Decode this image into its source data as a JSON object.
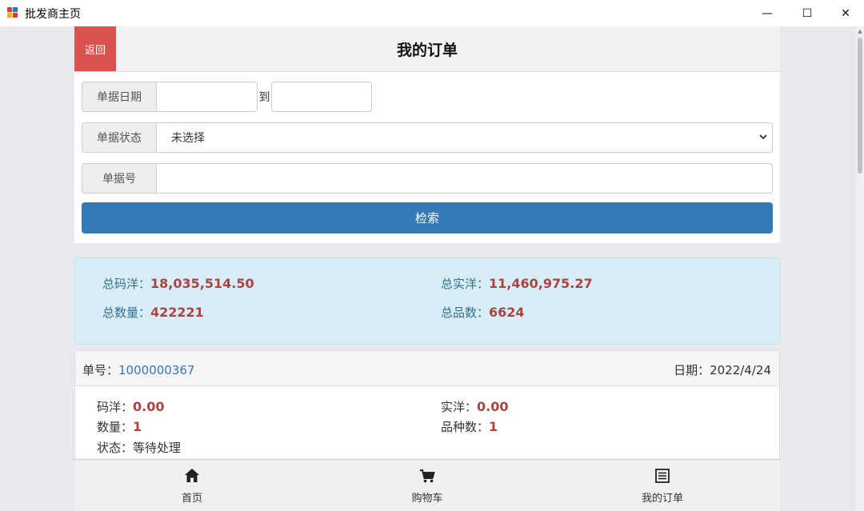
{
  "window": {
    "title": "批发商主页",
    "min_glyph": "—",
    "max_glyph": "☐",
    "close_glyph": "✕"
  },
  "header": {
    "back_label": "返回",
    "title": "我的订单"
  },
  "form": {
    "date_label": "单据日期",
    "date_from": "",
    "to_label": "到",
    "date_to": "",
    "status_label": "单据状态",
    "status_value": "未选择",
    "number_label": "单据号",
    "number_value": "",
    "search_label": "检索"
  },
  "summary": {
    "total_tag_label": "总码洋：",
    "total_tag_value": "18,035,514.50",
    "total_actual_label": "总实洋：",
    "total_actual_value": "11,460,975.27",
    "total_qty_label": "总数量：",
    "total_qty_value": "422221",
    "total_kinds_label": "总品数：",
    "total_kinds_value": "6624"
  },
  "order": {
    "no_label": "单号：",
    "no_value": "1000000367",
    "date_label": "日期：",
    "date_value": "2022/4/24",
    "tag_label": "码洋：",
    "tag_value": "0.00",
    "actual_label": "实洋：",
    "actual_value": "0.00",
    "qty_label": "数量：",
    "qty_value": "1",
    "kinds_label": "品种数：",
    "kinds_value": "1",
    "status_label": "状态：",
    "status_value": "等待处理"
  },
  "nav": {
    "items": [
      {
        "label": "首页",
        "icon": "home-icon"
      },
      {
        "label": "购物车",
        "icon": "cart-icon"
      },
      {
        "label": "我的订单",
        "icon": "list-icon"
      }
    ]
  },
  "colors": {
    "back_button": "#d9534f",
    "primary": "#337ab7",
    "summary_bg": "#d9edf7",
    "value_red": "#a94442"
  }
}
